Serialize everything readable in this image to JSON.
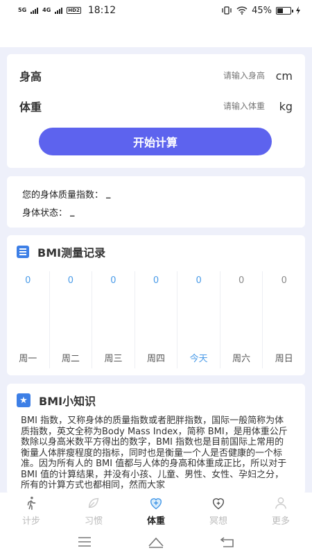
{
  "status": {
    "signal1": "5G",
    "signal2": "4G",
    "hd": "HD2",
    "time": "18:12",
    "battery": "45%",
    "battery_level": 0.45
  },
  "form": {
    "height_label": "身高",
    "height_placeholder": "请输入身高",
    "height_unit": "cm",
    "weight_label": "体重",
    "weight_placeholder": "请输入体重",
    "weight_unit": "kg",
    "calc_button": "开始计算"
  },
  "result": {
    "bmi_label": "您的身体质量指数：",
    "bmi_value": "_",
    "state_label": "身体状态：",
    "state_value": "_"
  },
  "records": {
    "title": "BMI测量记录",
    "days": [
      {
        "value": "0",
        "label": "周一"
      },
      {
        "value": "0",
        "label": "周二"
      },
      {
        "value": "0",
        "label": "周三"
      },
      {
        "value": "0",
        "label": "周四"
      },
      {
        "value": "0",
        "label": "今天"
      },
      {
        "value": "0",
        "label": "周六"
      },
      {
        "value": "0",
        "label": "周日"
      }
    ]
  },
  "knowledge": {
    "title": "BMI小知识",
    "text": "BMI 指数，又称身体的质量指数或者肥胖指数，国际一般简称为体质指数，英文全称为Body Mass Index，简称 BMI，是用体重公斤数除以身高米数平方得出的数字，BMI 指数也是目前国际上常用的衡量人体胖瘦程度的指标，同时也是衡量一个人是否健康的一个标准。因为所有人的 BMI 值都与人体的身高和体重成正比，所以对于 BMI 值的计算结果，并没有小孩、儿童、男性、女性、孕妇之分，所有的计算方式也都相同，然而大家"
  },
  "tabs": [
    {
      "label": "计步",
      "icon": "walk-icon"
    },
    {
      "label": "习惯",
      "icon": "leaf-icon"
    },
    {
      "label": "体重",
      "icon": "heart-plus-icon"
    },
    {
      "label": "冥想",
      "icon": "heart-icon"
    },
    {
      "label": "更多",
      "icon": "person-icon"
    }
  ],
  "colors": {
    "accent": "#5d63ee",
    "blue": "#4a9be8",
    "background": "#eef0fa"
  }
}
